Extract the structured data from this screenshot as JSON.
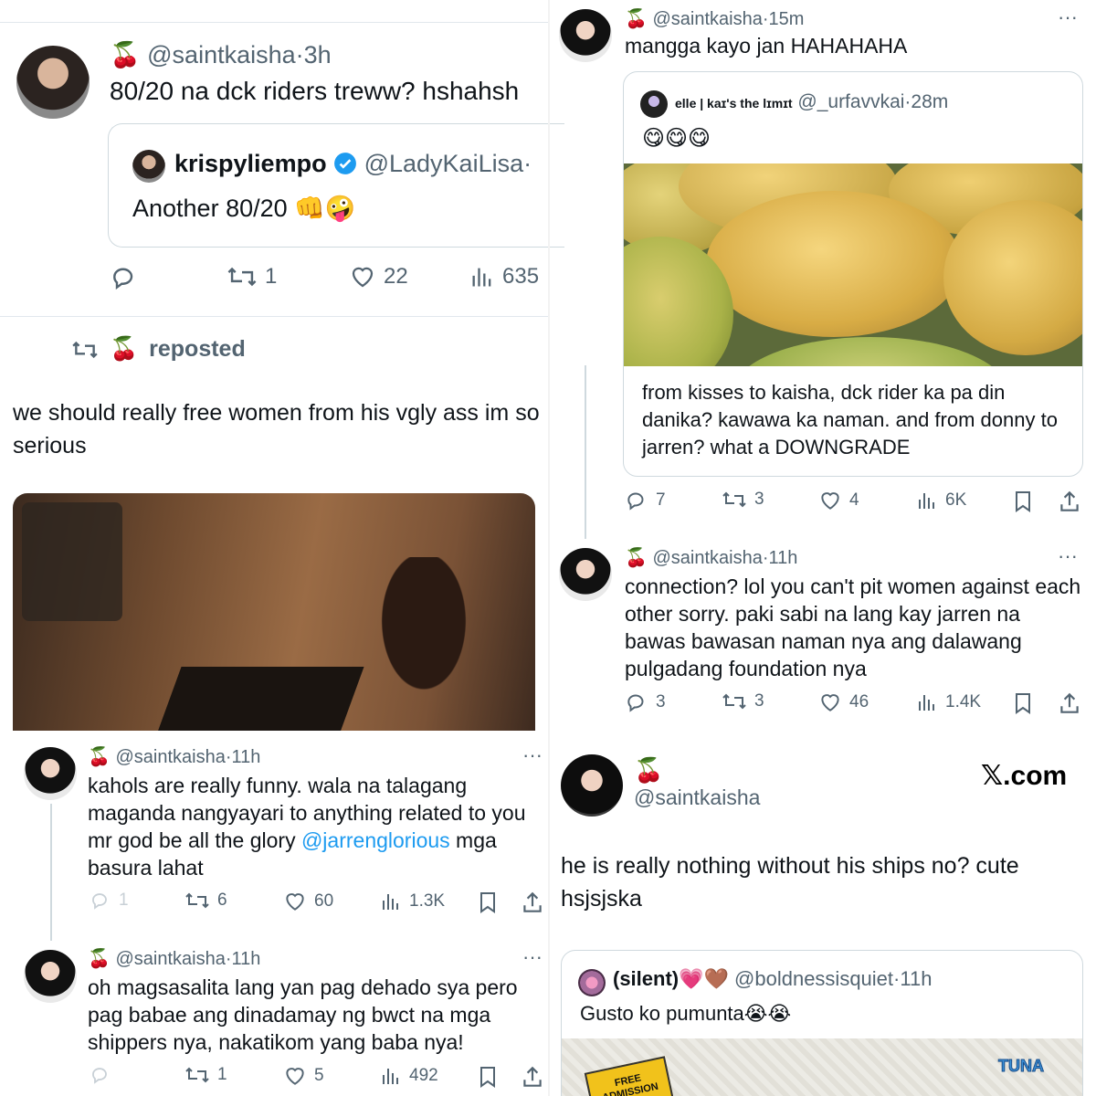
{
  "tl": {
    "cherry": "🍒",
    "handle": "@saintkaisha",
    "dot": "·",
    "time": "3h",
    "text": "80/20 na dck riders treww? hshahsh",
    "quote": {
      "name": "krispyliempo",
      "handle": "@LadyKaiLisa",
      "dot": "·",
      "text": "Another 80/20 👊🤪"
    },
    "stats": {
      "retweets": "1",
      "likes": "22",
      "views": "635"
    }
  },
  "repost": {
    "cherry": "🍒",
    "label": "reposted",
    "text": "we should really free women from his vgly ass im so serious"
  },
  "reply1": {
    "cherry": "🍒",
    "handle": "@saintkaisha",
    "dot": "·",
    "time": "11h",
    "more": "···",
    "text_a": "kahols are really funny. wala na talagang maganda nangyayari to anything related to you mr god be all the glory ",
    "mention": "@jarrenglorious",
    "text_b": " mga basura lahat",
    "stats": {
      "replies": "1",
      "retweets": "6",
      "likes": "60",
      "views": "1.3K"
    }
  },
  "reply2": {
    "cherry": "🍒",
    "handle": "@saintkaisha",
    "dot": "·",
    "time": "11h",
    "more": "···",
    "text": "oh magsasalita lang yan pag dehado sya pero pag babae ang dinadamay ng bwct na mga shippers nya, nakatikom yang baba nya!",
    "stats": {
      "retweets": "1",
      "likes": "5",
      "views": "492"
    }
  },
  "tr": {
    "cherry": "🍒",
    "handle": "@saintkaisha",
    "dot": "·",
    "time": "15m",
    "more": "···",
    "text": "mangga kayo jan HAHAHAHA",
    "quote": {
      "name": "elle | kaɪ's the lɪmɪt",
      "handle": "@_urfavvkai",
      "dot": "·",
      "time": "28m",
      "emojis": "😋😋😋",
      "below_text": "from kisses to kaisha, dck rider ka pa din danika? kawawa ka naman. and from donny to jarren? what a DOWNGRADE"
    },
    "stats": {
      "replies": "7",
      "retweets": "3",
      "likes": "4",
      "views": "6K"
    }
  },
  "reply3": {
    "cherry": "🍒",
    "handle": "@saintkaisha",
    "dot": "·",
    "time": "11h",
    "more": "···",
    "text": "connection? lol you can't pit women against each other sorry. paki sabi na lang kay jarren na bawas bawasan naman nya ang dalawang pulgadang foundation nya",
    "stats": {
      "replies": "3",
      "retweets": "3",
      "likes": "46",
      "views": "1.4K"
    }
  },
  "br": {
    "cherry": "🍒",
    "handle": "@saintkaisha",
    "brand": "𝕏.com",
    "text": "he is really nothing without his ships no? cute hsjsjska",
    "quote": {
      "name": "(silent)💗🤎",
      "handle": "@boldnessisquiet",
      "dot": "·",
      "time": "11h",
      "text": "Gusto ko pumunta😭😭",
      "badge1": "FREE ADMISSION",
      "badge2": "TUNA"
    }
  },
  "colors": {
    "link": "#1d9bf0",
    "muted": "#536471",
    "verified": "#1d9bf0",
    "border": "#cfd9de"
  }
}
